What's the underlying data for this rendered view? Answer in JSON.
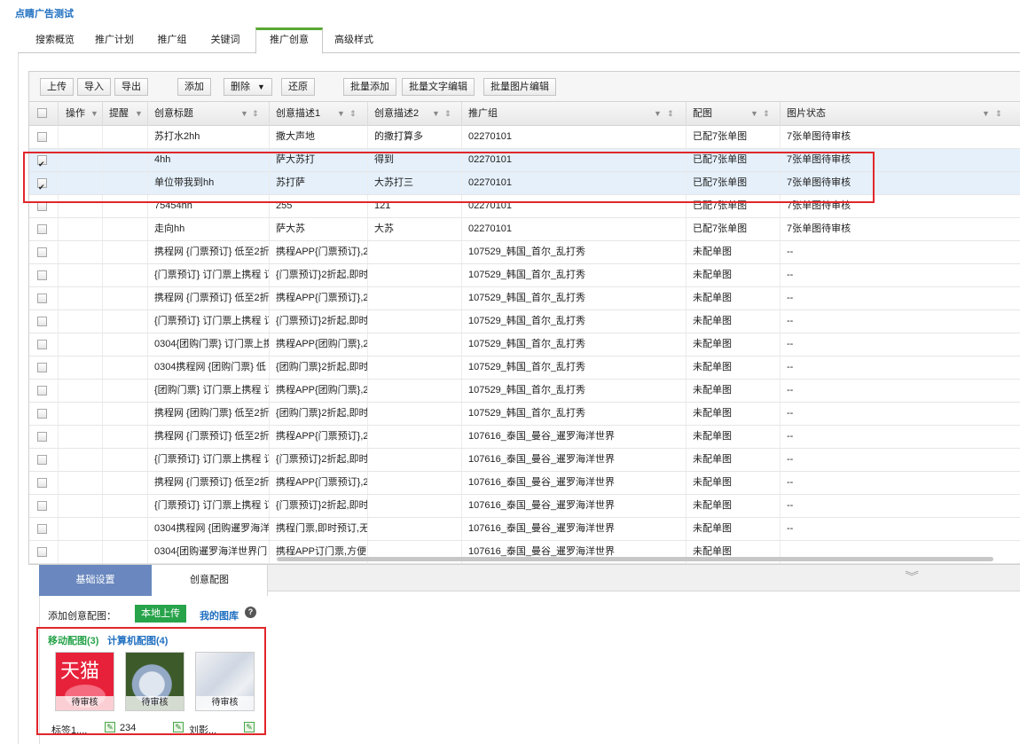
{
  "app": {
    "title": "点睛广告测试"
  },
  "tabs": [
    {
      "label": "搜索概览",
      "active": false
    },
    {
      "label": "推广计划",
      "active": false
    },
    {
      "label": "推广组",
      "active": false
    },
    {
      "label": "关键词",
      "active": false
    },
    {
      "label": "推广创意",
      "active": true
    },
    {
      "label": "高级样式",
      "active": false
    }
  ],
  "toolbar": {
    "upload": "上传",
    "import": "导入",
    "export": "导出",
    "add": "添加",
    "delete": "删除",
    "restore": "还原",
    "batch_add": "批量添加",
    "batch_text_edit": "批量文字编辑",
    "batch_image_edit": "批量图片编辑"
  },
  "table": {
    "columns": [
      "操作",
      "提醒",
      "创意标题",
      "创意描述1",
      "创意描述2",
      "推广组",
      "配图",
      "图片状态"
    ],
    "rows": [
      {
        "checked": false,
        "title": "苏打水2hh",
        "desc1": "撒大声地",
        "desc2": "的撒打算多",
        "group": "02270101",
        "image": "已配7张单图",
        "status": "7张单图待审核"
      },
      {
        "checked": true,
        "title": "4hh",
        "desc1": "萨大苏打",
        "desc2": "得到",
        "group": "02270101",
        "image": "已配7张单图",
        "status": "7张单图待审核"
      },
      {
        "checked": true,
        "title": "单位带我到hh",
        "desc1": "苏打萨",
        "desc2": "大苏打三",
        "group": "02270101",
        "image": "已配7张单图",
        "status": "7张单图待审核"
      },
      {
        "checked": false,
        "title": "75454hh",
        "desc1": "255",
        "desc2": "121",
        "group": "02270101",
        "image": "已配7张单图",
        "status": "7张单图待审核"
      },
      {
        "checked": false,
        "title": "走向hh",
        "desc1": "萨大苏",
        "desc2": "大苏",
        "group": "02270101",
        "image": "已配7张单图",
        "status": "7张单图待审核"
      },
      {
        "checked": false,
        "title": "携程网 {门票预订} 低至2折",
        "desc1": "携程APP{门票预订},2",
        "desc2": "",
        "group": "107529_韩国_首尔_乱打秀",
        "image": "未配单图",
        "status": "--"
      },
      {
        "checked": false,
        "title": "{门票预订} 订门票上携程 订",
        "desc1": "{门票预订}2折起,即时",
        "desc2": "",
        "group": "107529_韩国_首尔_乱打秀",
        "image": "未配单图",
        "status": "--"
      },
      {
        "checked": false,
        "title": "携程网 {门票预订} 低至2折",
        "desc1": "携程APP{门票预订},2",
        "desc2": "",
        "group": "107529_韩国_首尔_乱打秀",
        "image": "未配单图",
        "status": "--"
      },
      {
        "checked": false,
        "title": "{门票预订} 订门票上携程 订",
        "desc1": "{门票预订}2折起,即时",
        "desc2": "",
        "group": "107529_韩国_首尔_乱打秀",
        "image": "未配单图",
        "status": "--"
      },
      {
        "checked": false,
        "title": "0304{团购门票} 订门票上携",
        "desc1": "携程APP{团购门票},2",
        "desc2": "",
        "group": "107529_韩国_首尔_乱打秀",
        "image": "未配单图",
        "status": "--"
      },
      {
        "checked": false,
        "title": "0304携程网 {团购门票} 低",
        "desc1": "{团购门票}2折起,即时",
        "desc2": "",
        "group": "107529_韩国_首尔_乱打秀",
        "image": "未配单图",
        "status": "--"
      },
      {
        "checked": false,
        "title": "{团购门票} 订门票上携程 订",
        "desc1": "携程APP{团购门票},2",
        "desc2": "",
        "group": "107529_韩国_首尔_乱打秀",
        "image": "未配单图",
        "status": "--"
      },
      {
        "checked": false,
        "title": "携程网 {团购门票} 低至2折",
        "desc1": "{团购门票}2折起,即时",
        "desc2": "",
        "group": "107529_韩国_首尔_乱打秀",
        "image": "未配单图",
        "status": "--"
      },
      {
        "checked": false,
        "title": "携程网 {门票预订} 低至2折",
        "desc1": "携程APP{门票预订},2",
        "desc2": "",
        "group": "107616_泰国_曼谷_暹罗海洋世界",
        "image": "未配单图",
        "status": "--"
      },
      {
        "checked": false,
        "title": "{门票预订} 订门票上携程 订",
        "desc1": "{门票预订}2折起,即时",
        "desc2": "",
        "group": "107616_泰国_曼谷_暹罗海洋世界",
        "image": "未配单图",
        "status": "--"
      },
      {
        "checked": false,
        "title": "携程网 {门票预订} 低至2折",
        "desc1": "携程APP{门票预订},2",
        "desc2": "",
        "group": "107616_泰国_曼谷_暹罗海洋世界",
        "image": "未配单图",
        "status": "--"
      },
      {
        "checked": false,
        "title": "{门票预订} 订门票上携程 订",
        "desc1": "{门票预订}2折起,即时",
        "desc2": "",
        "group": "107616_泰国_曼谷_暹罗海洋世界",
        "image": "未配单图",
        "status": "--"
      },
      {
        "checked": false,
        "title": "0304携程网 {团购暹罗海洋",
        "desc1": "携程门票,即时预订,无",
        "desc2": "",
        "group": "107616_泰国_曼谷_暹罗海洋世界",
        "image": "未配单图",
        "status": "--"
      },
      {
        "checked": false,
        "title": "0304{团购暹罗海洋世界门",
        "desc1": "携程APP订门票,方便",
        "desc2": "",
        "group": "107616_泰国_曼谷_暹罗海洋世界",
        "image": "未配单图",
        "status": ""
      }
    ]
  },
  "bottom": {
    "tab_basic": "基础设置",
    "tab_images": "创意配图",
    "add_label": "添加创意配图：",
    "local_upload": "本地上传",
    "my_gallery": "我的图库",
    "help": "?",
    "mobile_tab": "移动配图(3)",
    "pc_tab": "计算机配图(4)",
    "thumbs": [
      {
        "status": "待审核",
        "label": "标签1,...",
        "brand": "天猫"
      },
      {
        "status": "待审核",
        "label": "234"
      },
      {
        "status": "待审核",
        "label": "刘影..."
      }
    ],
    "colors": {
      "accent_green": "#27a34a",
      "tab_blue": "#6a88bf",
      "highlight_red": "#e1262b"
    }
  }
}
